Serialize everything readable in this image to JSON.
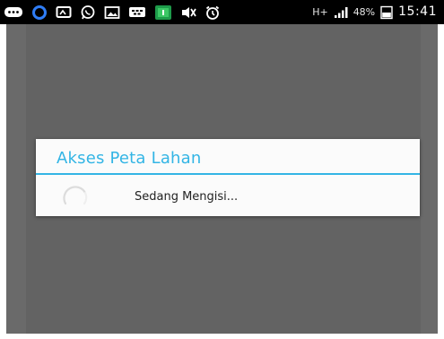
{
  "status_bar": {
    "icons": [
      "chat-bubble-icon",
      "messenger-icon",
      "cast-icon",
      "whatsapp-icon",
      "image-icon",
      "bbm-icon",
      "app-icon",
      "mute-icon",
      "alarm-icon",
      "network-icon",
      "signal-icon",
      "battery-icon"
    ],
    "network_label": "H+",
    "battery_percent": "48%",
    "battery_level": 0.48,
    "time": "15:41"
  },
  "dialog": {
    "title": "Akses Peta Lahan",
    "message": "Sedang Mengisi...",
    "accent_color": "#33b5e5"
  }
}
